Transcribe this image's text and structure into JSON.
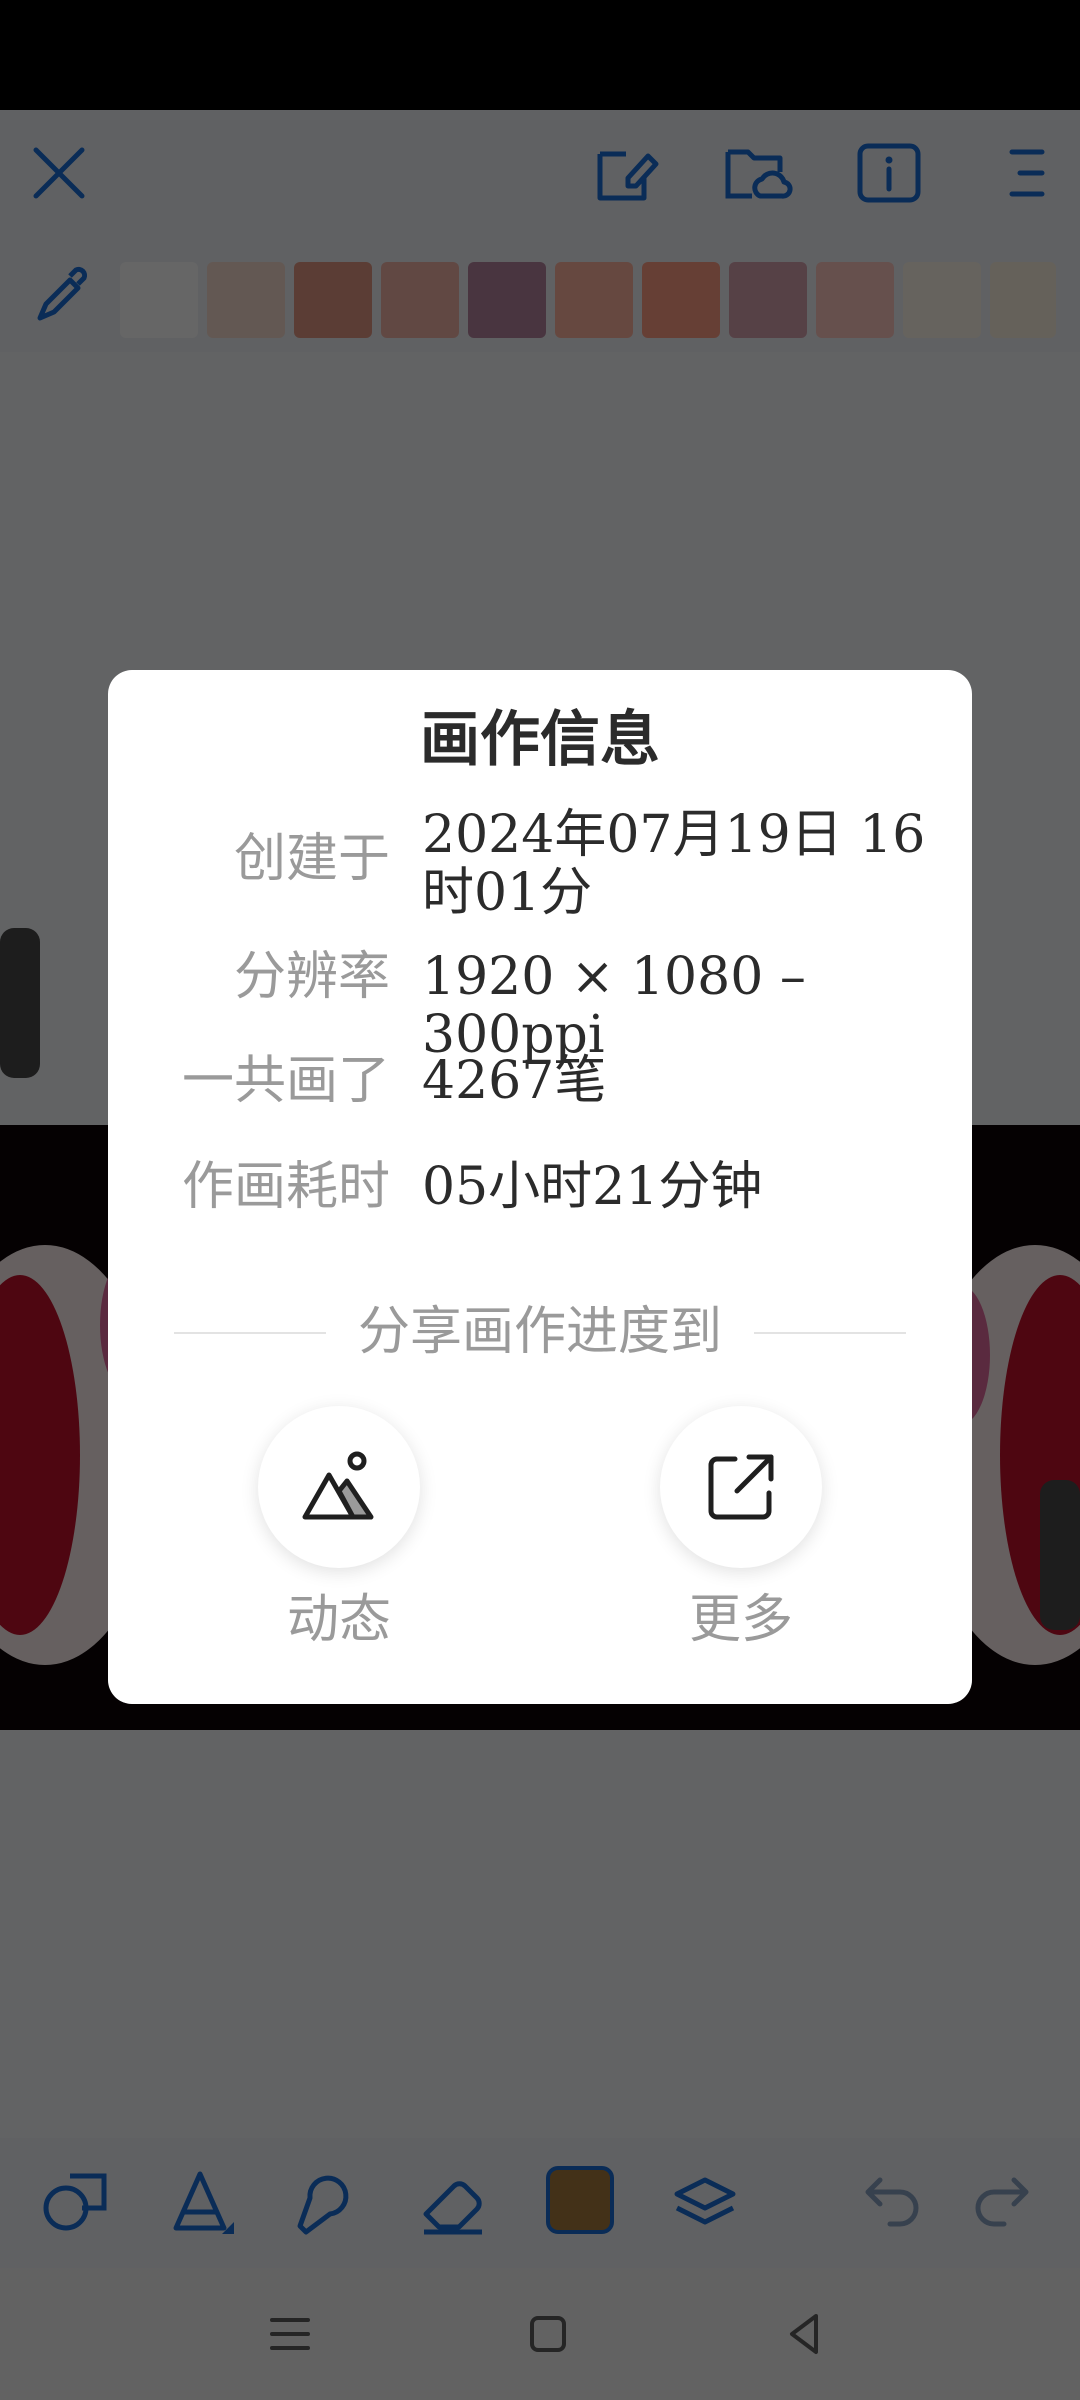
{
  "palette": {
    "swatches": [
      "#ffffff",
      "#f7dccf",
      "#e49a84",
      "#f2b4a8",
      "#b786a0",
      "#ffb4a0",
      "#ff9e86",
      "#d8a2b0",
      "#ffc7c0",
      "#fff8ea",
      "#fdf3e2"
    ]
  },
  "toolbar": {
    "current_color": "#a87a3e"
  },
  "dialog": {
    "title": "画作信息",
    "rows": [
      {
        "label": "创建于",
        "value": "2024年07月19日 16时01分"
      },
      {
        "label": "分辨率",
        "value": "1920 × 1080 – 300ppi"
      },
      {
        "label": "一共画了",
        "value": "4267笔"
      },
      {
        "label": "作画耗时",
        "value": "05小时21分钟"
      }
    ],
    "share_heading": "分享画作进度到",
    "share_options": [
      {
        "label": "动态",
        "icon": "image-icon"
      },
      {
        "label": "更多",
        "icon": "share-external-icon"
      }
    ]
  }
}
